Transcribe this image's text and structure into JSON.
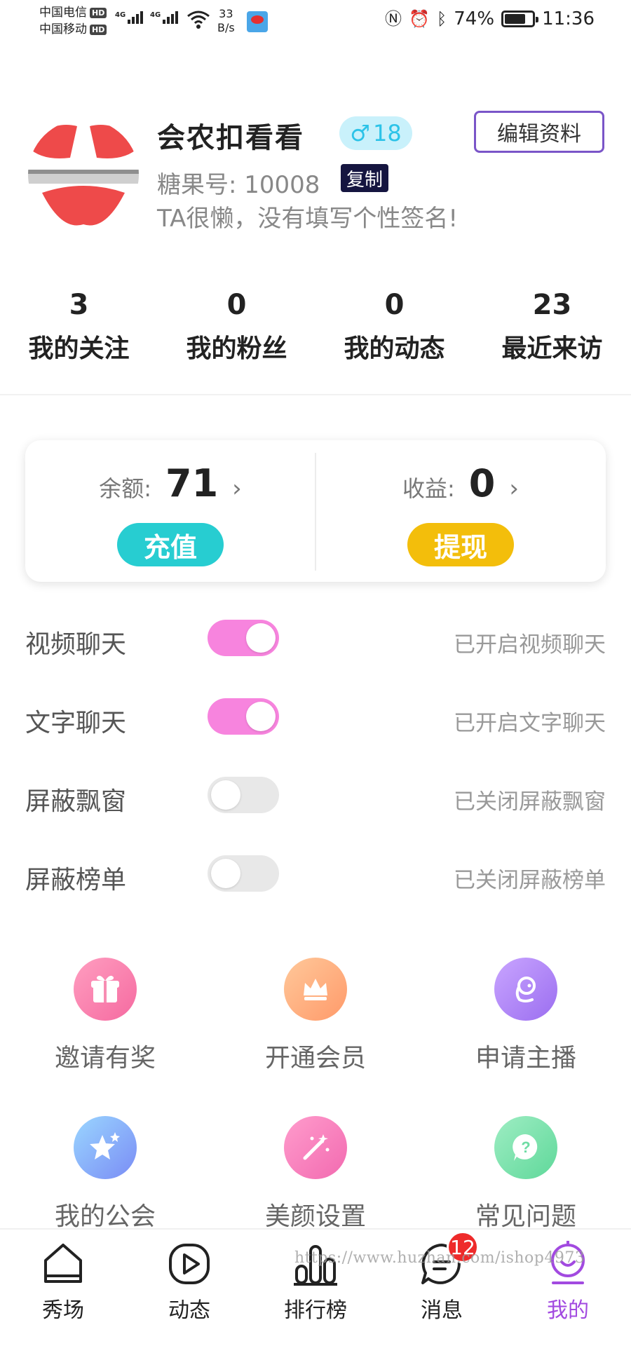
{
  "status_bar": {
    "carrier1": "中国电信",
    "carrier2": "中国移动",
    "hd": "HD",
    "net_type": "4G",
    "speed_value": "33",
    "speed_unit": "B/s",
    "battery": "74%",
    "time": "11:36"
  },
  "profile": {
    "nickname": "会农扣看看",
    "gender_symbol": "♂",
    "age": "18",
    "edit_label": "编辑资料",
    "user_id": "糖果号: 10008",
    "copy_label": "复制",
    "signature": "TA很懒，没有填写个性签名!"
  },
  "stats": [
    {
      "value": "3",
      "label": "我的关注"
    },
    {
      "value": "0",
      "label": "我的粉丝"
    },
    {
      "value": "0",
      "label": "我的动态"
    },
    {
      "value": "23",
      "label": "最近来访"
    }
  ],
  "wallet": {
    "balance_label": "余额:",
    "balance_value": "71",
    "recharge_label": "充值",
    "earnings_label": "收益:",
    "earnings_value": "0",
    "withdraw_label": "提现",
    "arrow": "›"
  },
  "toggles": [
    {
      "label": "视频聊天",
      "state": "on",
      "status": "已开启视频聊天"
    },
    {
      "label": "文字聊天",
      "state": "on",
      "status": "已开启文字聊天"
    },
    {
      "label": "屏蔽飘窗",
      "state": "off",
      "status": "已关闭屏蔽飘窗"
    },
    {
      "label": "屏蔽榜单",
      "state": "off",
      "status": "已关闭屏蔽榜单"
    }
  ],
  "grid": [
    {
      "label": "邀请有奖",
      "icon": "gift-icon",
      "color_from": "#ff9ec0",
      "color_to": "#f56aa0"
    },
    {
      "label": "开通会员",
      "icon": "crown-icon",
      "color_from": "#ffc89a",
      "color_to": "#ff9a6a"
    },
    {
      "label": "申请主播",
      "icon": "anchor-icon",
      "color_from": "#c9a5ff",
      "color_to": "#9b6ef0"
    },
    {
      "label": "我的公会",
      "icon": "star-icon",
      "color_from": "#9ad6ff",
      "color_to": "#7a8cf5"
    },
    {
      "label": "美颜设置",
      "icon": "magic-wand-icon",
      "color_from": "#ff9ccc",
      "color_to": "#f26ab0"
    },
    {
      "label": "常见问题",
      "icon": "question-icon",
      "color_from": "#9eedc3",
      "color_to": "#5fd89a"
    }
  ],
  "watermark": "https://www.huzhan.com/ishop4973",
  "tabbar": [
    {
      "label": "秀场",
      "icon": "home-icon"
    },
    {
      "label": "动态",
      "icon": "play-icon"
    },
    {
      "label": "排行榜",
      "icon": "ranking-icon"
    },
    {
      "label": "消息",
      "icon": "message-icon",
      "badge": "12"
    },
    {
      "label": "我的",
      "icon": "profile-icon",
      "active": true
    }
  ],
  "colors": {
    "accent": "#a24ae0",
    "toggle_on": "#f784de",
    "recharge": "#27cdd1",
    "withdraw": "#f3be0b"
  }
}
